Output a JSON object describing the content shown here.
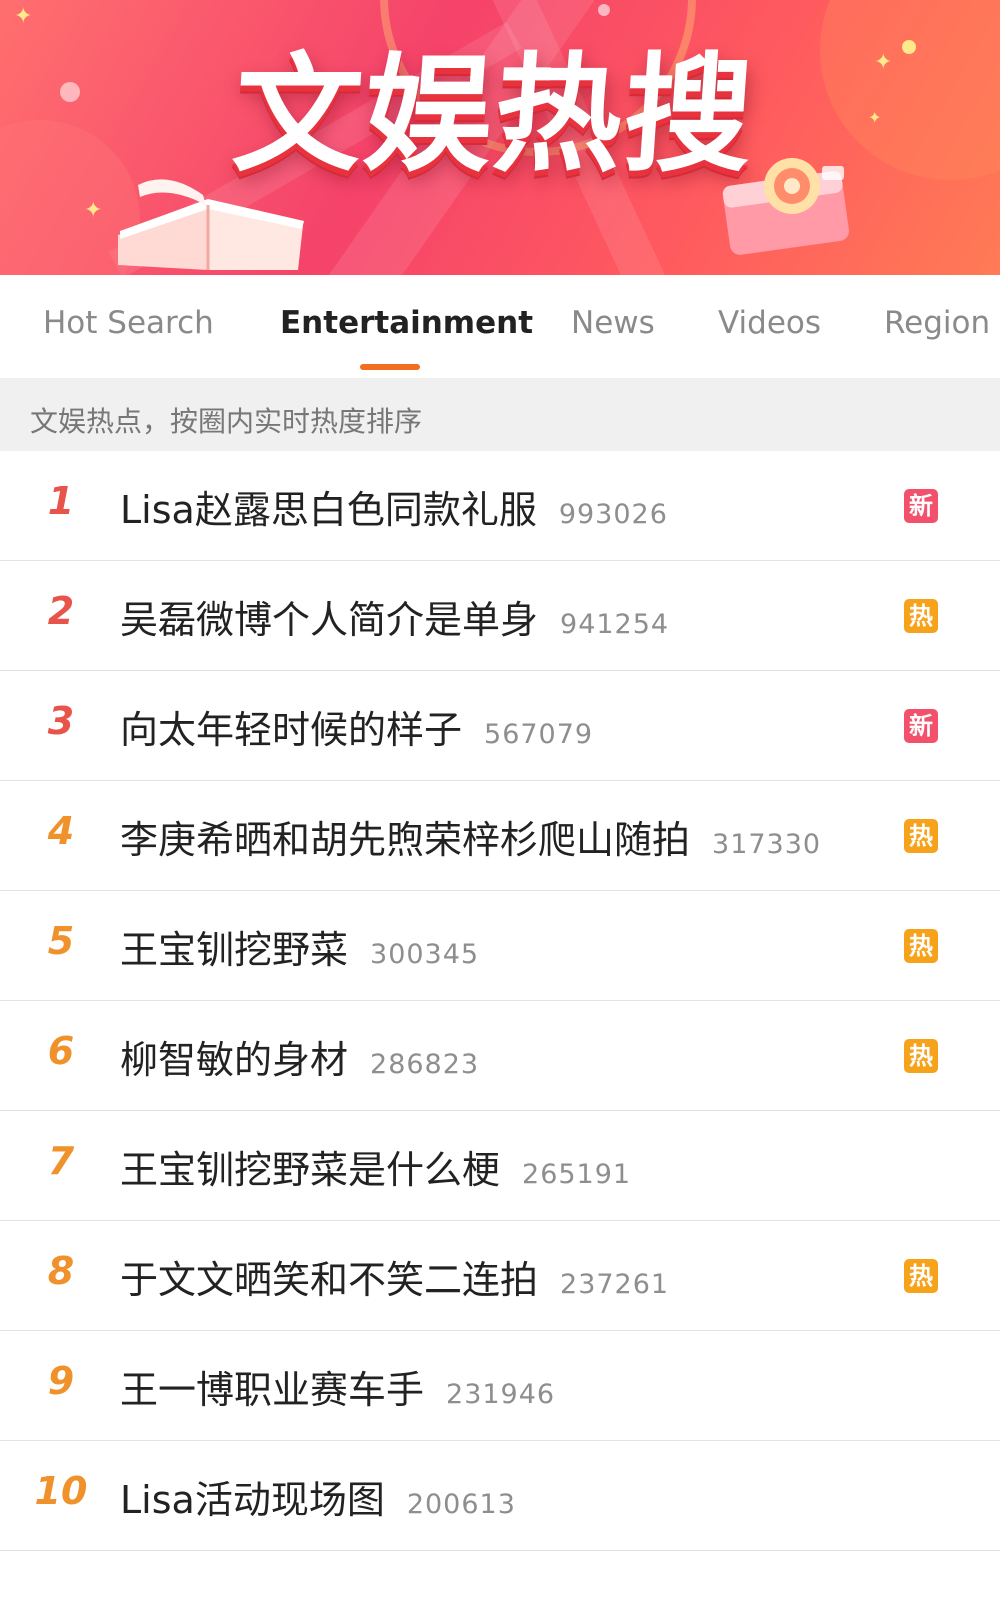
{
  "banner": {
    "title": "文娱热搜"
  },
  "tabs": [
    {
      "label": "Hot Search"
    },
    {
      "label": "Entertainment"
    },
    {
      "label": "News"
    },
    {
      "label": "Videos"
    },
    {
      "label": "Region"
    }
  ],
  "active_tab": "Entertainment",
  "subtitle": "文娱热点，按圈内实时热度排序",
  "colors": {
    "accent": "#f26d1f",
    "rank_top": "#e8534a",
    "rank_other": "#f0922b",
    "badge_new": "#f2506b",
    "badge_hot": "#f7a21b"
  },
  "items": [
    {
      "rank": "1",
      "title": "Lisa赵露思白色同款礼服",
      "count": "993026",
      "badge": "新",
      "badge_type": "new"
    },
    {
      "rank": "2",
      "title": "吴磊微博个人简介是单身",
      "count": "941254",
      "badge": "热",
      "badge_type": "hot"
    },
    {
      "rank": "3",
      "title": "向太年轻时候的样子",
      "count": "567079",
      "badge": "新",
      "badge_type": "new"
    },
    {
      "rank": "4",
      "title": "李庚希晒和胡先煦荣梓杉爬山随拍",
      "count": "317330",
      "badge": "热",
      "badge_type": "hot"
    },
    {
      "rank": "5",
      "title": "王宝钏挖野菜",
      "count": "300345",
      "badge": "热",
      "badge_type": "hot"
    },
    {
      "rank": "6",
      "title": "柳智敏的身材",
      "count": "286823",
      "badge": "热",
      "badge_type": "hot"
    },
    {
      "rank": "7",
      "title": "王宝钏挖野菜是什么梗",
      "count": "265191",
      "badge": "",
      "badge_type": ""
    },
    {
      "rank": "8",
      "title": "于文文晒笑和不笑二连拍",
      "count": "237261",
      "badge": "热",
      "badge_type": "hot"
    },
    {
      "rank": "9",
      "title": "王一博职业赛车手",
      "count": "231946",
      "badge": "",
      "badge_type": ""
    },
    {
      "rank": "10",
      "title": "Lisa活动现场图",
      "count": "200613",
      "badge": "",
      "badge_type": ""
    }
  ]
}
